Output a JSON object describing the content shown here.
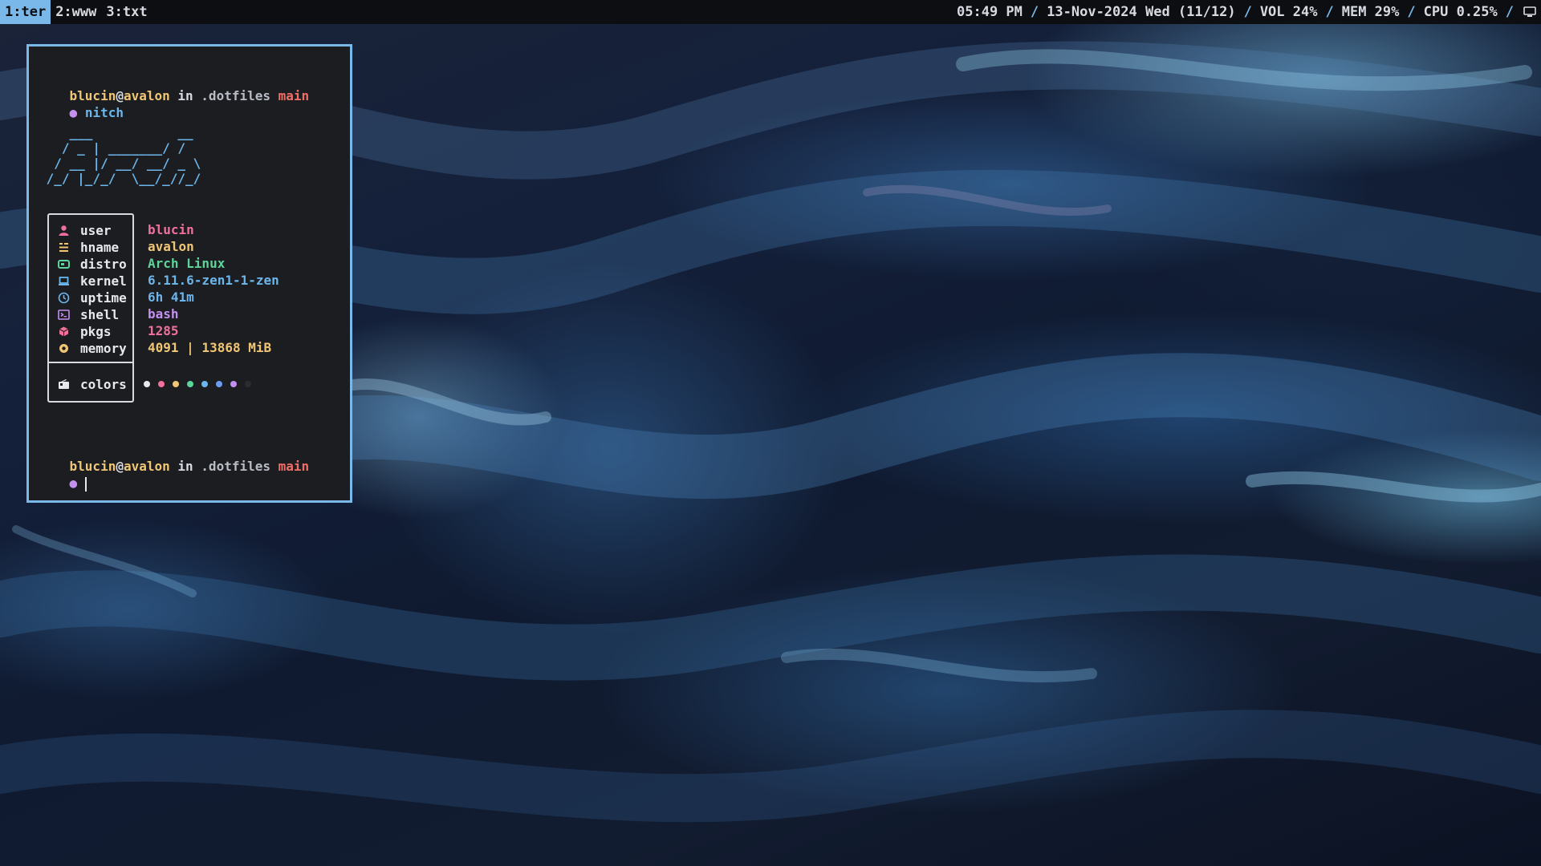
{
  "topbar": {
    "workspaces": [
      {
        "label": "1:ter",
        "active": true
      },
      {
        "label": "2:www",
        "active": false
      },
      {
        "label": "3:txt",
        "active": false
      }
    ],
    "time": "05:49 PM",
    "date": "13-Nov-2024 Wed (11/12)",
    "volume": "VOL 24%",
    "memory": "MEM 29%",
    "cpu": "CPU 0.25%",
    "separator": "/",
    "tray_icon": "monitor-icon"
  },
  "terminal": {
    "prompt": {
      "user": "blucin",
      "at": "@",
      "host": "avalon",
      "in": " in ",
      "dir": ".dotfiles",
      "branch": "main",
      "bullet": "●"
    },
    "command": "nitch",
    "ascii_logo": "    ___           __\n   / _ | _______/ /\n  / __ |/ __/ __/ _ \\\n /_/ |_/_/  \\__/_//_/",
    "info": [
      {
        "icon": "user-icon",
        "label": "user",
        "value": "blucin",
        "color": "#f0719b"
      },
      {
        "icon": "hostname-icon",
        "label": "hname",
        "value": "avalon",
        "color": "#f0c674"
      },
      {
        "icon": "distro-icon",
        "label": "distro",
        "value": "Arch Linux",
        "color": "#5dd49a"
      },
      {
        "icon": "laptop-icon",
        "label": "kernel",
        "value": "6.11.6-zen1-1-zen",
        "color": "#6cb6eb"
      },
      {
        "icon": "clock-icon",
        "label": "uptime",
        "value": "6h 41m",
        "color": "#6cb6eb"
      },
      {
        "icon": "terminal-icon",
        "label": "shell",
        "value": "bash",
        "color": "#c490f0"
      },
      {
        "icon": "package-icon",
        "label": "pkgs",
        "value": "1285",
        "color": "#f0719b"
      },
      {
        "icon": "memory-icon",
        "label": "memory",
        "value": "4091 | 13868 MiB",
        "color": "#f0c674"
      }
    ],
    "colors_label": "colors",
    "colors_icon": "palette-icon",
    "palette": [
      "#e6e8ec",
      "#f0719b",
      "#f0c674",
      "#5dd49a",
      "#6cb6eb",
      "#6c9cf0",
      "#c490f0",
      "#2a2c31"
    ]
  }
}
